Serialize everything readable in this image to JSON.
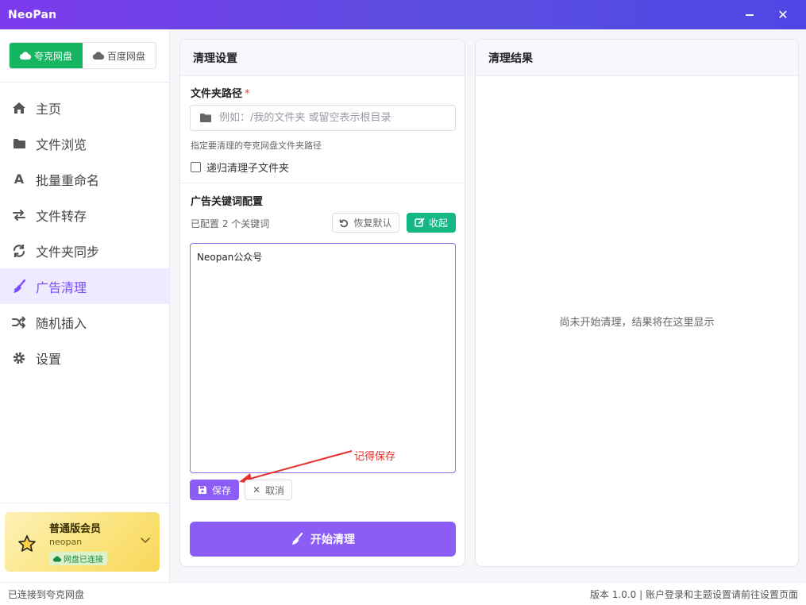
{
  "window": {
    "title": "NeoPan"
  },
  "drive_toggle": {
    "quark": "夸克网盘",
    "baidu": "百度网盘"
  },
  "nav": [
    {
      "label": "主页",
      "icon": "home-icon"
    },
    {
      "label": "文件浏览",
      "icon": "folder-icon"
    },
    {
      "label": "批量重命名",
      "icon": "font-icon"
    },
    {
      "label": "文件转存",
      "icon": "transfer-icon"
    },
    {
      "label": "文件夹同步",
      "icon": "sync-icon"
    },
    {
      "label": "广告清理",
      "icon": "broom-icon",
      "active": true
    },
    {
      "label": "随机插入",
      "icon": "shuffle-icon"
    },
    {
      "label": "设置",
      "icon": "gear-icon"
    }
  ],
  "member": {
    "title": "普通版会员",
    "username": "neopan",
    "status": "网盘已连接"
  },
  "settings_panel": {
    "title": "清理设置",
    "folder_label": "文件夹路径",
    "required_mark": "*",
    "folder_placeholder": "例如：/我的文件夹 或留空表示根目录",
    "folder_value": "",
    "folder_hint": "指定要清理的夸克网盘文件夹路径",
    "recursive_label": "递归清理子文件夹",
    "keywords_title": "广告关键词配置",
    "keywords_count": "已配置 2 个关键词",
    "restore_label": "恢复默认",
    "collapse_label": "收起",
    "keywords_text": "Neopan公众号",
    "save_label": "保存",
    "cancel_label": "取消",
    "annotation": "记得保存",
    "start_label": "开始清理"
  },
  "results_panel": {
    "title": "清理结果",
    "empty_text": "尚未开始清理，结果将在这里显示"
  },
  "statusbar": {
    "left": "已连接到夸克网盘",
    "right": "版本 1.0.0 | 账户登录和主题设置请前往设置页面"
  },
  "colors": {
    "accent": "#8b5cf6",
    "quark_green": "#16b562",
    "collapse_green": "#15b884",
    "annotation_red": "#e8302a"
  }
}
